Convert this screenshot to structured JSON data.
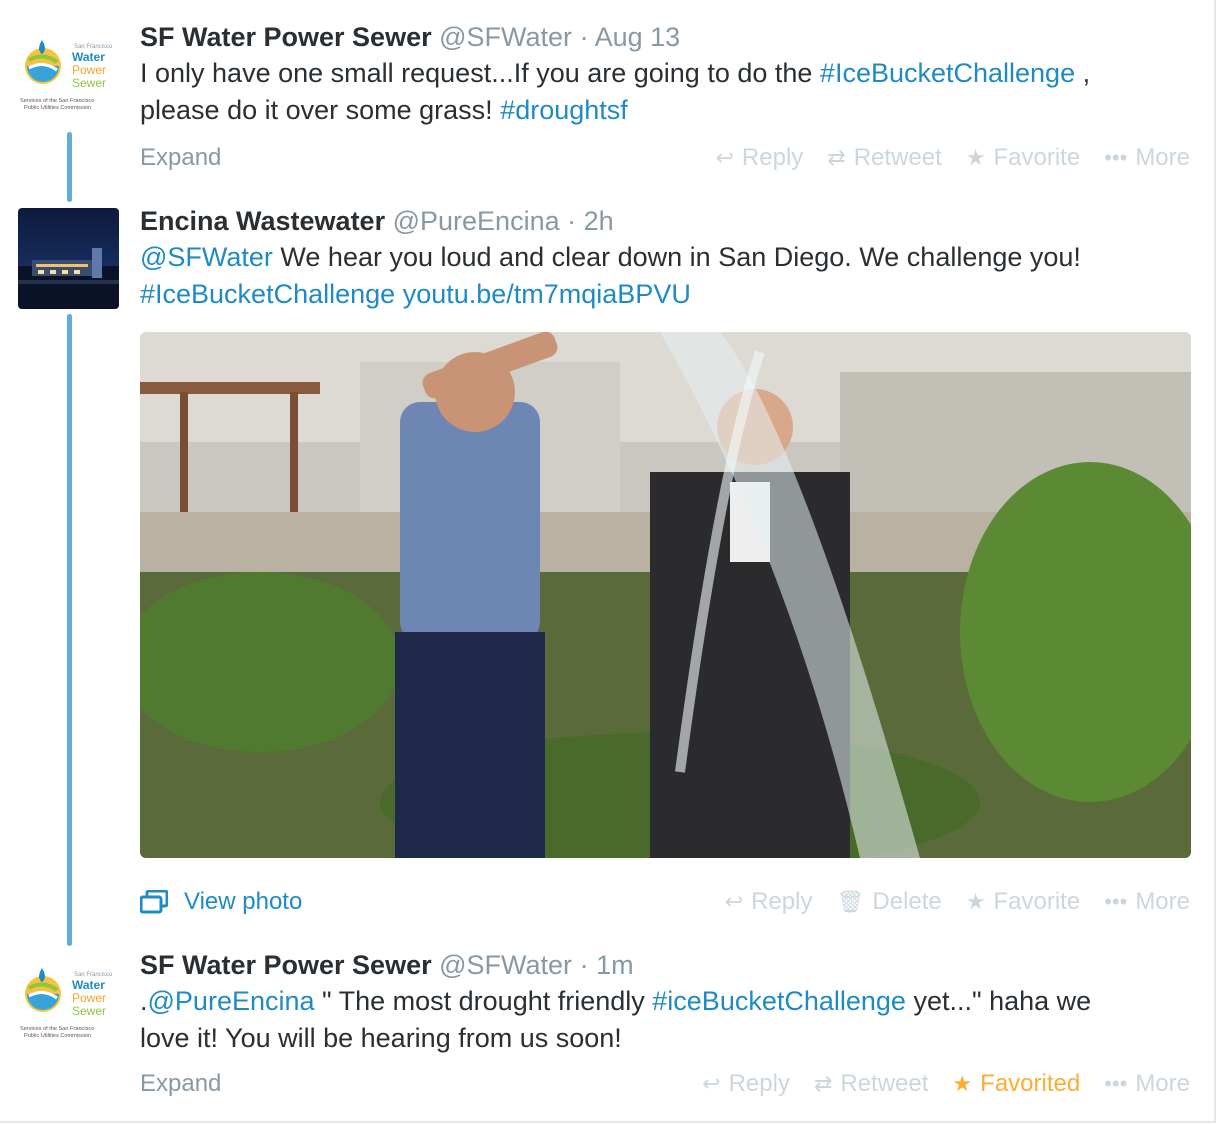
{
  "tweets": [
    {
      "fullname": "SF Water Power Sewer",
      "username": "@SFWater",
      "time": "Aug 13",
      "text_1": "I only have one small request...If you are going to do the ",
      "hashtag_1": "#IceBucketChallenge",
      "text_2": " ,",
      "text_3": "please do it over some grass! ",
      "hashtag_2": "#droughtsf",
      "footer_left": "Expand",
      "actions": {
        "reply": "Reply",
        "retweet": "Retweet",
        "favorite": "Favorite",
        "more": "More"
      },
      "avatar": {
        "small": "San Francisco",
        "l1": "Water",
        "l2": "Power",
        "l3": "Sewer",
        "caption_1": "Services of the San Francisco",
        "caption_2": "Public Utilities Commission"
      }
    },
    {
      "fullname": "Encina Wastewater",
      "username": "@PureEncina",
      "time": "2h",
      "mention": "@SFWater",
      "text_1": " We hear you loud and clear down in San Diego. We challenge you!",
      "hashtag": "#IceBucketChallenge",
      "url": "youtu.be/tm7mqiaBPVU",
      "footer_left": "View photo",
      "actions": {
        "reply": "Reply",
        "delete": "Delete",
        "favorite": "Favorite",
        "more": "More"
      }
    },
    {
      "fullname": "SF Water Power Sewer",
      "username": "@SFWater",
      "time": "1m",
      "lead": ".",
      "mention": "@PureEncina",
      "text_1": " \" The most drought friendly ",
      "hashtag": "#iceBucketChallenge",
      "text_2": " yet...\" haha we",
      "text_3": "love it! You will be hearing from us soon!",
      "footer_left": "Expand",
      "actions": {
        "reply": "Reply",
        "retweet": "Retweet",
        "favorite": "Favorited",
        "more": "More"
      },
      "avatar": {
        "small": "San Francisco",
        "l1": "Water",
        "l2": "Power",
        "l3": "Sewer",
        "caption_1": "Services of the San Francisco",
        "caption_2": "Public Utilities Commission"
      }
    }
  ],
  "colors": {
    "link": "#1f8bc4",
    "muted": "#8899a6",
    "action": "#ccd6dd",
    "favorited": "#ffac33",
    "thread": "#5faed8"
  }
}
